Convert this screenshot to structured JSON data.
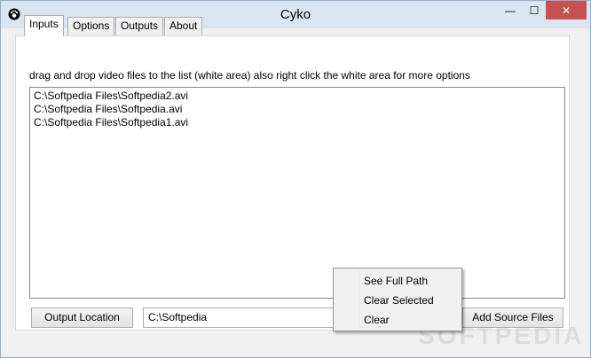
{
  "window": {
    "title": "Cyko",
    "close_symbol": "✕",
    "minimize_symbol": "—",
    "maximize_symbol": "☐"
  },
  "tabs": [
    {
      "label": "Inputs",
      "active": true
    },
    {
      "label": "Options",
      "active": false
    },
    {
      "label": "Outputs",
      "active": false
    },
    {
      "label": "About",
      "active": false
    }
  ],
  "inputs": {
    "hint": "drag and drop video files to the list (white area) also right click the white area for more options",
    "files": [
      "C:\\Softpedia Files\\Softpedia2.avi",
      "C:\\Softpedia Files\\Softpedia.avi",
      "C:\\Softpedia Files\\Softpedia1.avi"
    ],
    "output_location_label": "Output Location",
    "output_path_value": "C:\\Softpedia",
    "add_source_label": "Add Source Files"
  },
  "context_menu": {
    "items": [
      "See Full Path",
      "Clear Selected",
      "Clear"
    ]
  },
  "watermark": "SOFTPEDIA",
  "colors": {
    "close_button": "#c75050",
    "titlebar": "#d9e6f2",
    "window_bg": "#f0f0f0"
  },
  "icons": {
    "app": "paw-icon"
  }
}
